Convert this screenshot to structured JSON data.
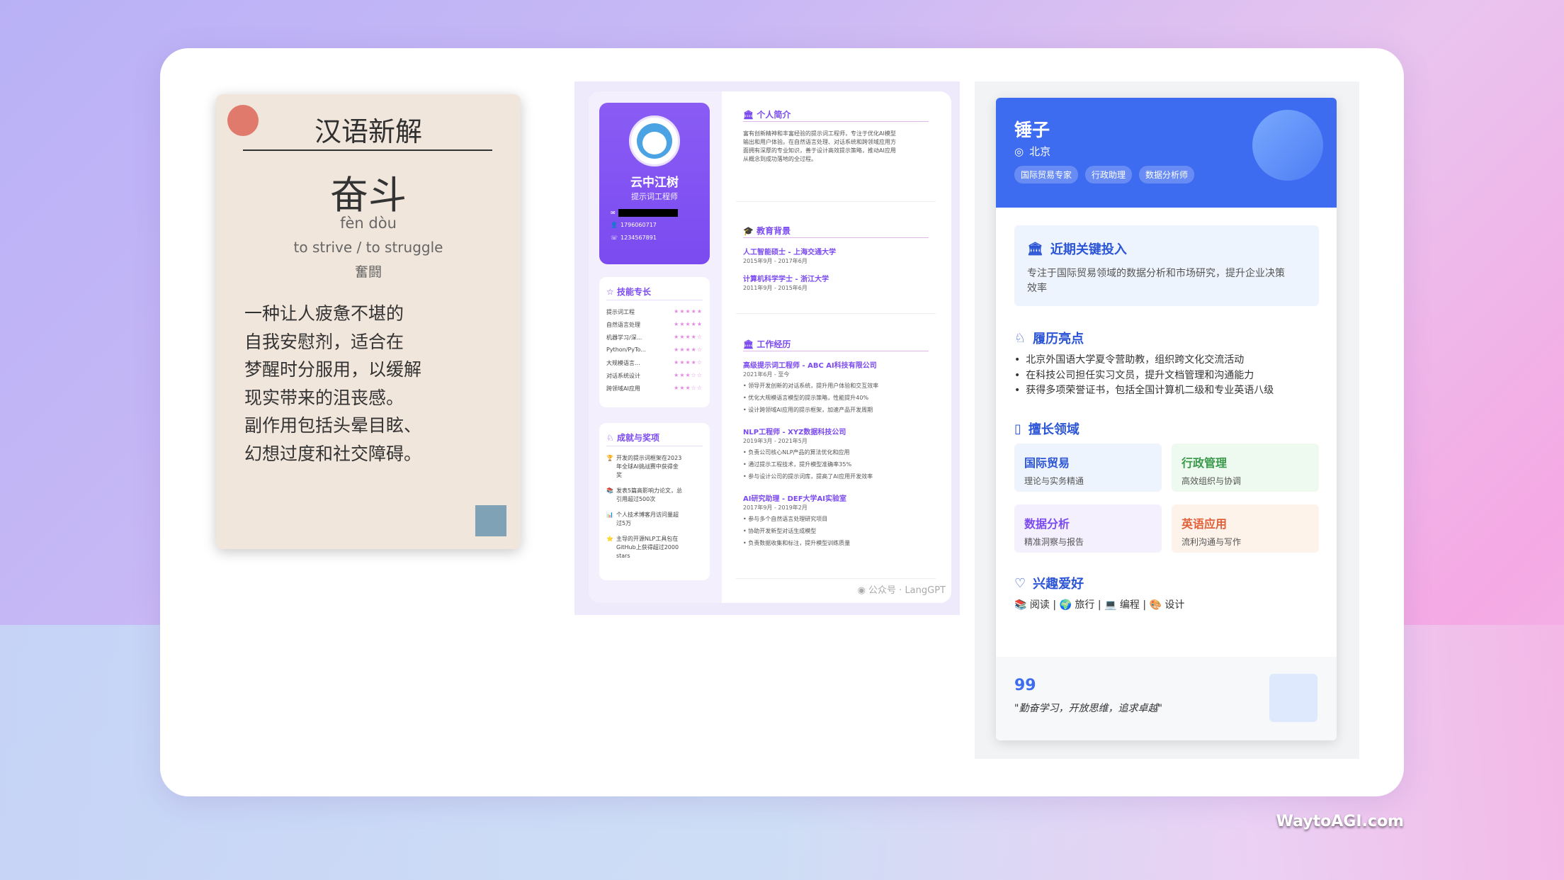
{
  "site_watermark": "WaytoAGI.com",
  "card1": {
    "title": "汉语新解",
    "word": "奋斗",
    "pinyin": "fèn dòu",
    "english": "to strive / to struggle",
    "japanese": "奮闘",
    "body_lines": [
      "一种让人疲惫不堪的",
      "自我安慰剂，适合在",
      "梦醒时分服用，以缓解",
      "现实带来的沮丧感。",
      "副作用包括头晕目眩、",
      "幻想过度和社交障碍。"
    ],
    "colors": {
      "dot": "#df7a6c",
      "square": "#7fa2b6",
      "background": "#f1e6dc"
    }
  },
  "card2": {
    "name": "云中江树",
    "role": "提示词工程师",
    "qq": "1796060717",
    "phone": "1234567891",
    "skills_title": "技能专长",
    "skills": [
      {
        "name": "提示词工程",
        "stars": "★★★★★"
      },
      {
        "name": "自然语言处理",
        "stars": "★★★★★"
      },
      {
        "name": "机器学习/深...",
        "stars": "★★★★☆"
      },
      {
        "name": "Python/PyTo...",
        "stars": "★★★★☆"
      },
      {
        "name": "大规模语言...",
        "stars": "★★★★☆"
      },
      {
        "name": "对话系统设计",
        "stars": "★★★☆☆"
      },
      {
        "name": "跨领域AI应用",
        "stars": "★★★☆☆"
      }
    ],
    "awards_title": "成就与奖项",
    "awards": [
      {
        "icon": "🏆",
        "lines": [
          "开发的提示词框架在2023",
          "年全球AI挑战赛中获得金",
          "奖"
        ]
      },
      {
        "icon": "📚",
        "lines": [
          "发表5篇高影响力论文，总",
          "引用超过500次"
        ]
      },
      {
        "icon": "📊",
        "lines": [
          "个人技术博客月访问量超",
          "过5万"
        ]
      },
      {
        "icon": "⭐",
        "lines": [
          "主导的开源NLP工具包在",
          "GitHub上获得超过2000",
          "stars"
        ]
      }
    ],
    "intro_title": "个人简介",
    "intro_lines": [
      "富有创新精神和丰富经验的提示词工程师，专注于优化AI模型",
      "输出和用户体验。在自然语言处理、对话系统和跨领域应用方",
      "面拥有深厚的专业知识，善于设计高效提示策略，推动AI应用",
      "从概念到成功落地的全过程。"
    ],
    "edu_title": "教育背景",
    "education": [
      {
        "degree": "人工智能硕士 - 上海交通大学",
        "date": "2015年9月 - 2017年6月"
      },
      {
        "degree": "计算机科学学士 - 浙江大学",
        "date": "2011年9月 - 2015年6月"
      }
    ],
    "work_title": "工作经历",
    "work": [
      {
        "title": "高级提示词工程师 - ABC AI科技有限公司",
        "date": "2021年6月 - 至今",
        "bullets": [
          "领导开发创新的对话系统，提升用户体验和交互效率",
          "优化大规模语言模型的提示策略，性能提升40%",
          "设计跨领域AI应用的提示框架，加速产品开发周期"
        ]
      },
      {
        "title": "NLP工程师 - XYZ数据科技公司",
        "date": "2019年3月 - 2021年5月",
        "bullets": [
          "负责公司核心NLP产品的算法优化和应用",
          "通过提示工程技术，提升模型准确率35%",
          "参与设计公司的提示词库，提高了AI应用开发效率"
        ]
      },
      {
        "title": "AI研究助理 - DEF大学AI实验室",
        "date": "2017年9月 - 2019年2月",
        "bullets": [
          "参与多个自然语言处理研究项目",
          "协助开发新型对话生成模型",
          "负责数据收集和标注，提升模型训练质量"
        ]
      }
    ],
    "wechat_mark": "公众号 · LangGPT",
    "colors": {
      "accent": "#7b4bf0",
      "stars": "#e28be0"
    }
  },
  "card3": {
    "name": "锤子",
    "location": "北京",
    "tags": [
      "国际贸易专家",
      "行政助理",
      "数据分析师"
    ],
    "focus_title": "近期关键投入",
    "focus_lines": [
      "专注于国际贸易领域的数据分析和市场研究，提升企业决策",
      "效率"
    ],
    "highlights_title": "履历亮点",
    "highlights": [
      "北京外国语大学夏令营助教，组织跨文化交流活动",
      "在科技公司担任实习文员，提升文档管理和沟通能力",
      "获得多项荣誉证书，包括全国计算机二级和专业英语八级"
    ],
    "skills_title": "擅长领域",
    "skills": [
      {
        "title": "国际贸易",
        "sub": "理论与实务精通",
        "color": "#2c55d6",
        "bg": "#eef4fe"
      },
      {
        "title": "行政管理",
        "sub": "高效组织与协调",
        "color": "#3a9a4a",
        "bg": "#eefaf0"
      },
      {
        "title": "数据分析",
        "sub": "精准洞察与报告",
        "color": "#7b4bf0",
        "bg": "#f4f0fd"
      },
      {
        "title": "英语应用",
        "sub": "流利沟通与写作",
        "color": "#e0603a",
        "bg": "#fdf3ea"
      }
    ],
    "hobbies_title": "兴趣爱好",
    "hobbies": "📚 阅读 | 🌍 旅行 | 💻 编程 | 🎨 设计",
    "quote_mark": "99",
    "quote": "\"勤奋学习，开放思维，追求卓越\"",
    "colors": {
      "header": "#3e6cf0"
    }
  }
}
